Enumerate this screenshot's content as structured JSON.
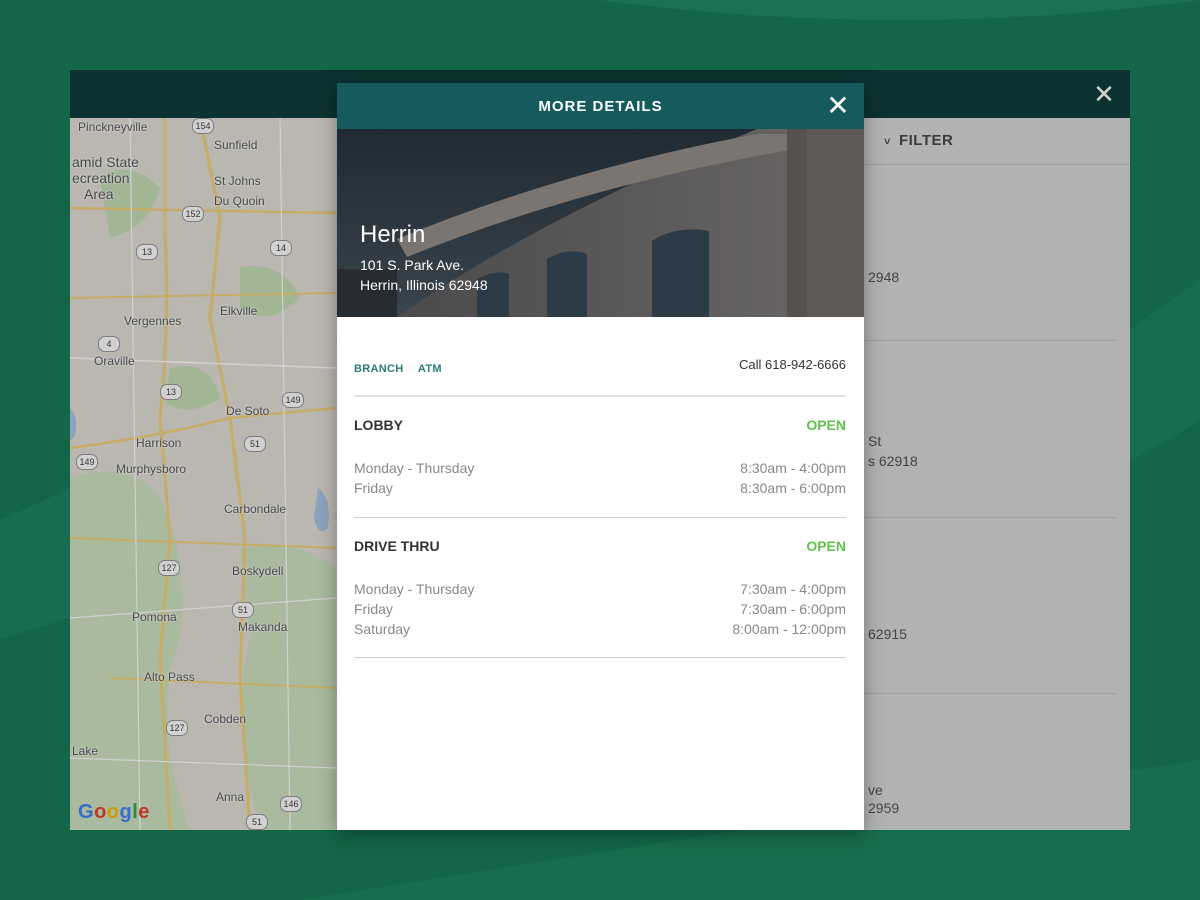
{
  "window": {
    "close_icon": "close-icon"
  },
  "map": {
    "labels": [
      "Pinckneyville",
      "amid State",
      "ecreation",
      "Area",
      "Sunfield",
      "St Johns",
      "Du Quoin",
      "Vergennes",
      "Elkville",
      "Oraville",
      "De Soto",
      "Harrison",
      "Murphysboro",
      "Carbondale",
      "Boskydell",
      "Pomona",
      "Makanda",
      "Alto Pass",
      "Cobden",
      "Lake",
      "Anna"
    ],
    "shields": [
      "154",
      "152",
      "13",
      "14",
      "4",
      "13",
      "149",
      "51",
      "149",
      "127",
      "51",
      "127",
      "146",
      "51"
    ],
    "attribution": "Google"
  },
  "list": {
    "filter_label": "FILTER",
    "items": [
      {
        "line1": "",
        "line2": "2948"
      },
      {
        "line1": "St",
        "line2": "s 62918"
      },
      {
        "line1": "",
        "line2": "62915"
      },
      {
        "line1": "ve",
        "line2": "2959"
      }
    ]
  },
  "modal": {
    "title": "MORE DETAILS",
    "close_icon": "close-icon",
    "branch_name": "Herrin",
    "address_line1": "101 S. Park Ave.",
    "address_line2": "Herrin, Illinois 62948",
    "tags": [
      "BRANCH",
      "ATM"
    ],
    "call_text": "Call 618-942-6666",
    "lobby": {
      "title": "LOBBY",
      "status": "OPEN",
      "hours": [
        {
          "day": "Monday - Thursday",
          "time": "8:30am - 4:00pm"
        },
        {
          "day": "Friday",
          "time": "8:30am - 6:00pm"
        }
      ]
    },
    "drive_thru": {
      "title": "DRIVE THRU",
      "status": "OPEN",
      "hours": [
        {
          "day": "Monday - Thursday",
          "time": "7:30am - 4:00pm"
        },
        {
          "day": "Friday",
          "time": "7:30am - 6:00pm"
        },
        {
          "day": "Saturday",
          "time": "8:00am - 12:00pm"
        }
      ]
    }
  },
  "colors": {
    "background": "#136648",
    "header": "#155a5d",
    "open_status": "#5fc24d",
    "tag": "#2b7a78"
  }
}
